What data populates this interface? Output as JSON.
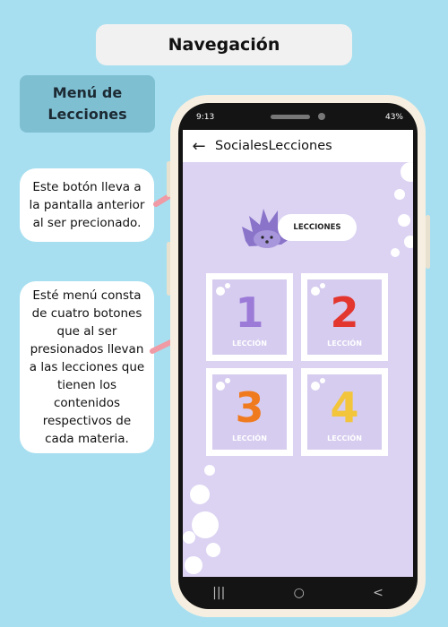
{
  "header": {
    "title": "Navegación"
  },
  "menu_box": {
    "label_line1": "Menú de",
    "label_line2": "Lecciones"
  },
  "annotations": {
    "back_note": [
      "Este botón lleva a",
      "la pantalla anterior",
      "al ser precionado."
    ],
    "menu_note": [
      "Esté menú consta",
      "de cuatro botones",
      "que al ser",
      "presionados llevan",
      "a las lecciones que",
      "tienen los",
      "contenidos",
      "respectivos de",
      "cada materia."
    ]
  },
  "phone": {
    "status_time": "9:13",
    "status_battery": "43%",
    "app_title": "SocialesLecciones",
    "banner_label": "LECCIONES",
    "lessons": [
      {
        "number": "1",
        "label": "LECCIÓN",
        "color": "#9b7ad8"
      },
      {
        "number": "2",
        "label": "LECCIÓN",
        "color": "#e2362f"
      },
      {
        "number": "3",
        "label": "LECCIÓN",
        "color": "#f07a1e"
      },
      {
        "number": "4",
        "label": "LECCIÓN",
        "color": "#f3c53a"
      }
    ],
    "nav": {
      "recent": "|||",
      "home": "○",
      "back": "<"
    }
  },
  "colors": {
    "background": "#a7dff0",
    "screen": "#dcd3f3",
    "arrow": "#ef9aa5"
  }
}
